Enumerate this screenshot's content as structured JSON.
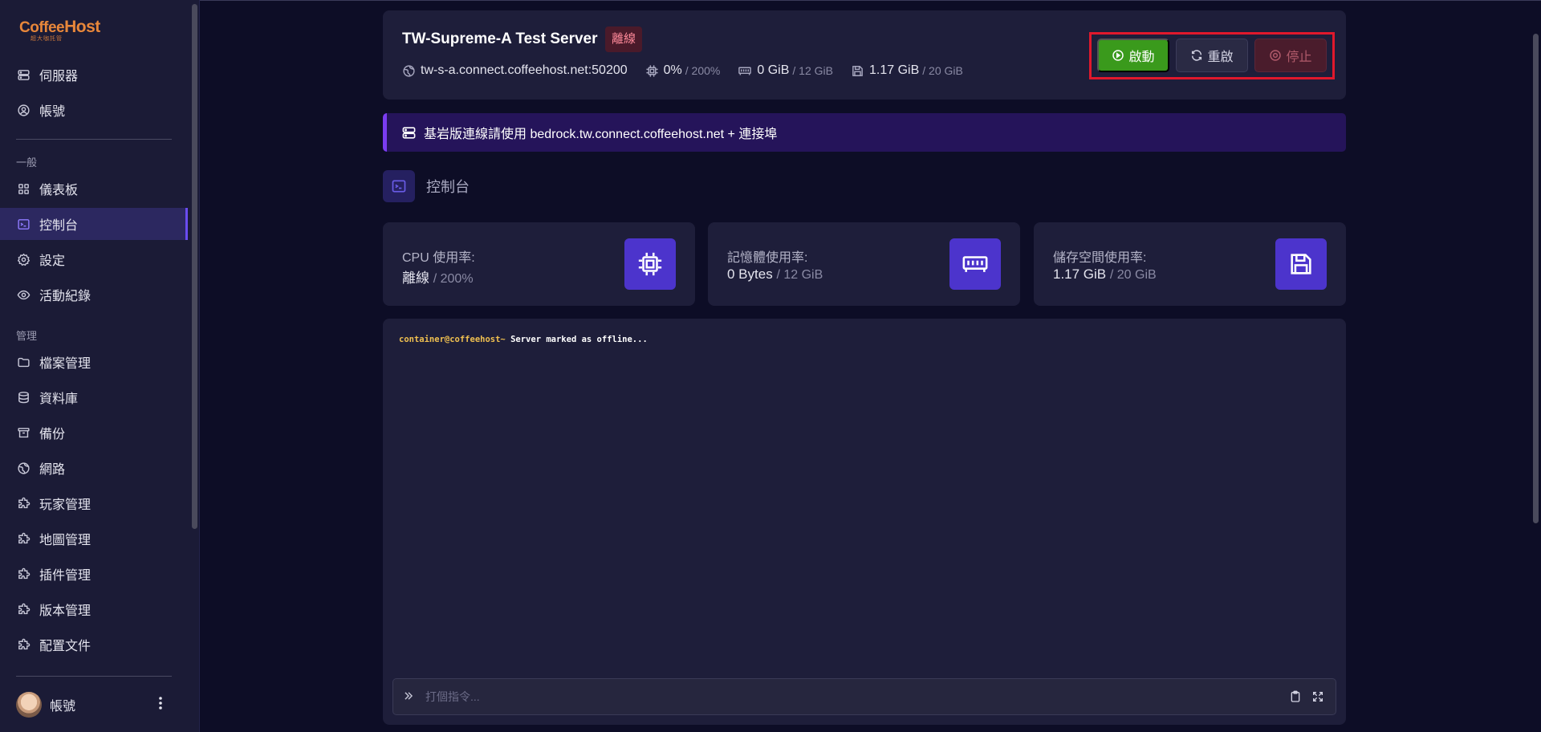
{
  "sidebar": {
    "logo": {
      "line1a": "Coffee",
      "line1b": "Host",
      "line2": "超大咖託管"
    },
    "top_items": [
      {
        "label": "伺服器",
        "icon": "server-icon"
      },
      {
        "label": "帳號",
        "icon": "user-circle-icon"
      }
    ],
    "section_general": "一般",
    "general_items": [
      {
        "label": "儀表板",
        "icon": "grid-icon"
      },
      {
        "label": "控制台",
        "icon": "terminal-icon",
        "active": true
      },
      {
        "label": "設定",
        "icon": "gear-icon"
      },
      {
        "label": "活動紀錄",
        "icon": "eye-icon"
      }
    ],
    "section_manage": "管理",
    "manage_items": [
      {
        "label": "檔案管理",
        "icon": "folder-icon"
      },
      {
        "label": "資料庫",
        "icon": "database-icon"
      },
      {
        "label": "備份",
        "icon": "archive-icon"
      },
      {
        "label": "網路",
        "icon": "globe-icon"
      },
      {
        "label": "玩家管理",
        "icon": "puzzle-icon"
      },
      {
        "label": "地圖管理",
        "icon": "puzzle-icon"
      },
      {
        "label": "插件管理",
        "icon": "puzzle-icon"
      },
      {
        "label": "版本管理",
        "icon": "puzzle-icon"
      },
      {
        "label": "配置文件",
        "icon": "puzzle-icon"
      }
    ],
    "user": {
      "name": "帳號"
    }
  },
  "header": {
    "title": "TW-Supreme-A Test Server",
    "status_badge": "離線",
    "address": "tw-s-a.connect.coffeehost.net:50200",
    "cpu": "0%",
    "cpu_limit": "/ 200%",
    "memory": "0 GiB",
    "memory_limit": "/ 12 GiB",
    "disk": "1.17 GiB",
    "disk_limit": "/ 20 GiB",
    "buttons": {
      "start": "啟動",
      "restart": "重啟",
      "stop": "停止"
    }
  },
  "notice": {
    "text": "基岩版連線請使用 bedrock.tw.connect.coffeehost.net + 連接埠"
  },
  "section": {
    "title": "控制台"
  },
  "stats": [
    {
      "label": "CPU 使用率:",
      "value": "離線",
      "limit": "/ 200%",
      "icon": "cpu-chip-icon"
    },
    {
      "label": "記憶體使用率:",
      "value": "0 Bytes",
      "limit": "/ 12 GiB",
      "icon": "memory-icon"
    },
    {
      "label": "儲存空間使用率:",
      "value": "1.17 GiB",
      "limit": "/ 20 GiB",
      "icon": "floppy-disk-icon"
    }
  ],
  "console": {
    "prompt": "container@coffeehost~",
    "message": " Server marked as offline...",
    "input_placeholder": "打個指令..."
  },
  "colors": {
    "accent": "#6a4cf0",
    "start_green": "#3a9a1c",
    "offline_badge": "#4a1a2a",
    "highlight_outline": "#e0182c"
  }
}
